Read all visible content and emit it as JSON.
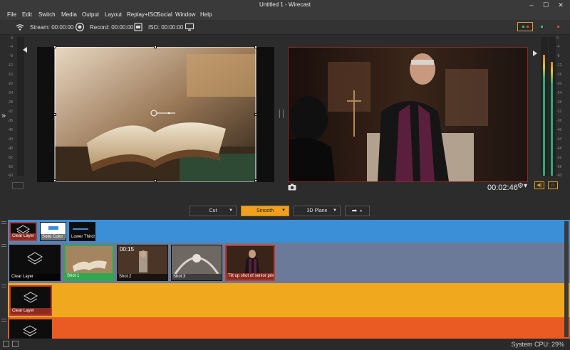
{
  "window": {
    "title": "Untitled 1 - Wirecast"
  },
  "menu": [
    "File",
    "Edit",
    "Switch",
    "Media",
    "Output",
    "Layout",
    "Replay+ISO",
    "Social",
    "Window",
    "Help"
  ],
  "toolbar": {
    "stream_label": "Stream: 00:00:00",
    "record_label": "Record: 00:00:00",
    "iso_label": "ISO: 00:00:00"
  },
  "preview": {
    "scale": [
      "0",
      "-4",
      "-8",
      "-12",
      "-16",
      "-20",
      "-24",
      "-28",
      "-32",
      "-36",
      "-40",
      "-44",
      "-48",
      "-52",
      "-56",
      "-60"
    ]
  },
  "live": {
    "time": "00:02:46"
  },
  "transitions": {
    "cut": "Cut",
    "smooth": "Smooth",
    "plane": "3D Plane"
  },
  "layers": [
    {
      "color": "#3b8fd6",
      "shots": [
        {
          "label": "Clear Layer"
        },
        {
          "label": "Solid Color 1"
        },
        {
          "label": "Lower Thirds"
        }
      ]
    },
    {
      "color": "#6b7a99",
      "shots": [
        {
          "label": "Clear Layer"
        },
        {
          "label": "Shot 1"
        },
        {
          "label": "Shot 2",
          "timer": "00:15"
        },
        {
          "label": "Shot 3"
        },
        {
          "label": "Tilt up shot of senior priest"
        }
      ]
    },
    {
      "color": "#f0a91f",
      "shots": [
        {
          "label": "Clear Layer"
        }
      ]
    },
    {
      "color": "#ea5a23",
      "shots": [
        {
          "label": ""
        }
      ]
    }
  ],
  "status": {
    "cpu": "System CPU: 29%"
  },
  "colors": {
    "accent": "#f0a01e",
    "live_border": "#8a2a23",
    "selected": "#c0392b",
    "active_green": "#2fa84f"
  }
}
